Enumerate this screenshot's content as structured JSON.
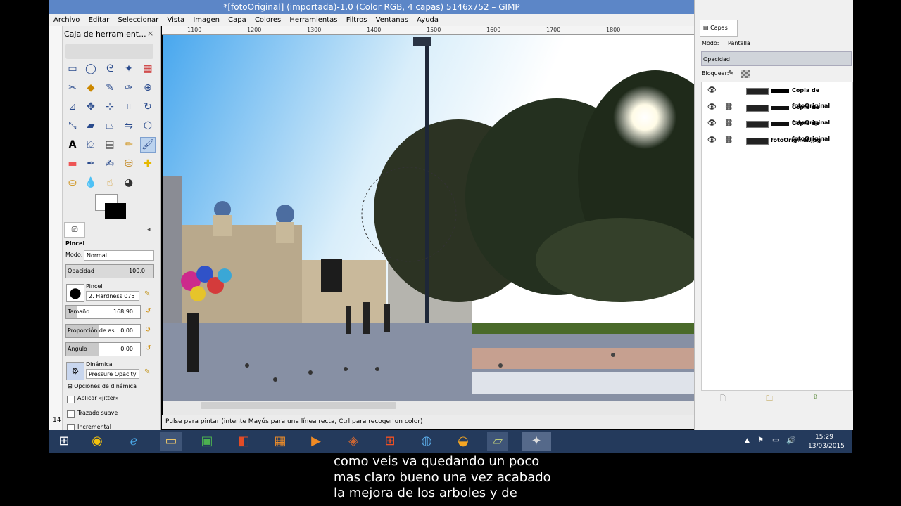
{
  "window": {
    "title": "*[fotoOriginal] (importada)-1.0 (Color RGB, 4 capas) 5146x752 – GIMP"
  },
  "menu": [
    "Archivo",
    "Editar",
    "Seleccionar",
    "Vista",
    "Imagen",
    "Capa",
    "Colores",
    "Herramientas",
    "Filtros",
    "Ventanas",
    "Ayuda"
  ],
  "toolbox": {
    "title": "Caja de herramient...",
    "close": "×",
    "tool_name": "Pincel",
    "mode_label": "Modo:",
    "mode_value": "Normal",
    "opacity_label": "Opacidad",
    "opacity_value": "100,0",
    "brush_label": "Pincel",
    "brush_value": "2. Hardness 075",
    "size_label": "Tamaño",
    "size_value": "168,90",
    "aspect_label": "Proporción de as...",
    "aspect_value": "0,00",
    "angle_label": "Ángulo",
    "angle_value": "0,00",
    "dynamics_label": "Dinámica",
    "dynamics_value": "Pressure Opacity",
    "dyn_options": "Opciones de dinámica",
    "jitter": "Aplicar «jitter»",
    "smooth": "Trazado suave",
    "incremental": "Incremental",
    "left_num": "14"
  },
  "ruler": [
    "1100",
    "1200",
    "1300",
    "1400",
    "1500",
    "1600",
    "1700",
    "1800"
  ],
  "status": "Pulse para pintar (intente Mayús para una línea recta, Ctrl para recoger un color)",
  "layers": {
    "tab": "Capas",
    "mode_label": "Modo:",
    "mode_value": "Pantalla",
    "opacity_label": "Opacidad",
    "lock_label": "Bloquear:",
    "items": [
      "Copia de fotoOriginal",
      "Copia de fotoOriginal",
      "Copia de fotoOriginal",
      "fotoOriginal.jpg"
    ]
  },
  "taskbar": {
    "time": "15:29",
    "date": "13/03/2015"
  },
  "subtitle": [
    "como veis va quedando un poco",
    "mas claro bueno una vez acabado",
    "la mejora de los arboles y de"
  ]
}
